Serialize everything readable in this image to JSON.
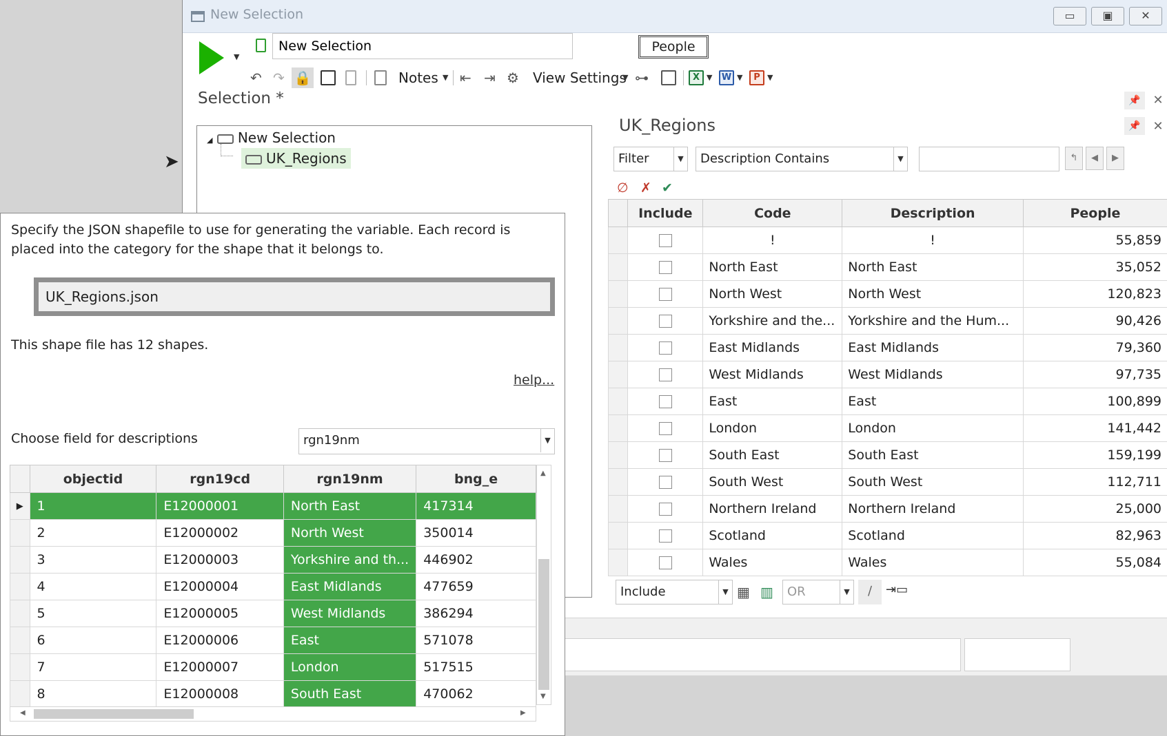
{
  "window": {
    "title": "New Selection",
    "controls": {
      "minimize": "▭",
      "maximize": "▣",
      "close": "✕"
    }
  },
  "toolbar": {
    "selection_name": "New Selection",
    "people_tag": "People",
    "notes_label": "Notes",
    "view_settings_label": "View Settings"
  },
  "selection": {
    "heading": "Selection *",
    "tree": {
      "root": "New Selection",
      "child": "UK_Regions"
    }
  },
  "uk_panel": {
    "title": "UK_Regions",
    "filter_mode": "Filter",
    "filter_type": "Description Contains",
    "filter_value": "",
    "columns": [
      "Include",
      "Code",
      "Description",
      "People"
    ],
    "rows": [
      {
        "code": "!",
        "description": "!",
        "people": "55,859"
      },
      {
        "code": "North East",
        "description": "North East",
        "people": "35,052"
      },
      {
        "code": "North West",
        "description": "North West",
        "people": "120,823"
      },
      {
        "code": "Yorkshire and the...",
        "description": "Yorkshire and the Hum...",
        "people": "90,426"
      },
      {
        "code": "East Midlands",
        "description": "East Midlands",
        "people": "79,360"
      },
      {
        "code": "West Midlands",
        "description": "West Midlands",
        "people": "97,735"
      },
      {
        "code": "East",
        "description": "East",
        "people": "100,899"
      },
      {
        "code": "London",
        "description": "London",
        "people": "141,442"
      },
      {
        "code": "South East",
        "description": "South East",
        "people": "159,199"
      },
      {
        "code": "South West",
        "description": "South West",
        "people": "112,711"
      },
      {
        "code": "Northern Ireland",
        "description": "Northern Ireland",
        "people": "25,000"
      },
      {
        "code": "Scotland",
        "description": "Scotland",
        "people": "82,963"
      },
      {
        "code": "Wales",
        "description": "Wales",
        "people": "55,084"
      }
    ],
    "bottom_mode": "Include",
    "bottom_logic": "OR"
  },
  "wizard": {
    "intro": "Specify the JSON shapefile to use for generating the variable. Each record is placed into the category for the shape that it belongs to.",
    "shapefile": "UK_Regions.json",
    "shape_count": "This shape file has 12 shapes.",
    "help_link": "help...",
    "desc_label": "Choose field for descriptions",
    "desc_field": "rgn19nm",
    "columns": [
      "objectid",
      "rgn19cd",
      "rgn19nm",
      "bng_e"
    ],
    "rows": [
      {
        "objectid": "1",
        "rgn19cd": "E12000001",
        "rgn19nm": "North East",
        "bng_e": "417314"
      },
      {
        "objectid": "2",
        "rgn19cd": "E12000002",
        "rgn19nm": "North West",
        "bng_e": "350014"
      },
      {
        "objectid": "3",
        "rgn19cd": "E12000003",
        "rgn19nm": "Yorkshire and th...",
        "bng_e": "446902"
      },
      {
        "objectid": "4",
        "rgn19cd": "E12000004",
        "rgn19nm": "East Midlands",
        "bng_e": "477659"
      },
      {
        "objectid": "5",
        "rgn19cd": "E12000005",
        "rgn19nm": "West Midlands",
        "bng_e": "386294"
      },
      {
        "objectid": "6",
        "rgn19cd": "E12000006",
        "rgn19nm": "East",
        "bng_e": "571078"
      },
      {
        "objectid": "7",
        "rgn19cd": "E12000007",
        "rgn19nm": "London",
        "bng_e": "517515"
      },
      {
        "objectid": "8",
        "rgn19cd": "E12000008",
        "rgn19nm": "South East",
        "bng_e": "470062"
      }
    ]
  },
  "colors": {
    "accent_green": "#43a649",
    "play_green": "#1bb100"
  }
}
